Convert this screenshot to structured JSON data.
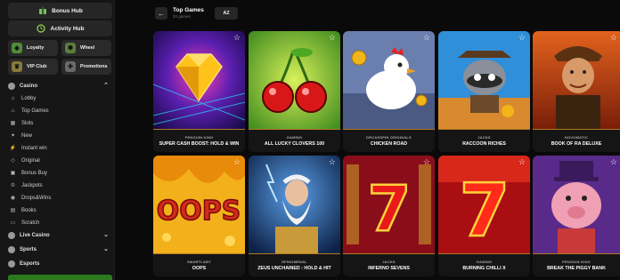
{
  "sidebar": {
    "bonus_hub": "Bonus Hub",
    "activity_hub": "Activity Hub",
    "tiles": [
      {
        "label": "Loyalty",
        "icon": "shield-icon"
      },
      {
        "label": "Wheel",
        "icon": "wheel-icon"
      },
      {
        "label": "VIP Club",
        "icon": "crown-icon"
      },
      {
        "label": "Promotions",
        "icon": "gift-icon"
      }
    ],
    "casino_label": "Casino",
    "items": [
      {
        "label": "Lobby",
        "icon": "home-icon"
      },
      {
        "label": "Top Games",
        "icon": "flame-icon"
      },
      {
        "label": "Slots",
        "icon": "slot-icon"
      },
      {
        "label": "New",
        "icon": "new-icon"
      },
      {
        "label": "Instant win",
        "icon": "bolt-icon"
      },
      {
        "label": "Original",
        "icon": "diamond-icon"
      },
      {
        "label": "Bonus Buy",
        "icon": "cart-icon"
      },
      {
        "label": "Jackpots",
        "icon": "trophy-icon"
      },
      {
        "label": "Drops&Wins",
        "icon": "drop-icon"
      },
      {
        "label": "Books",
        "icon": "book-icon"
      },
      {
        "label": "Scratch",
        "icon": "ticket-icon"
      }
    ],
    "live_casino": "Live Casino",
    "sports": "Sports",
    "esports": "Esports"
  },
  "header": {
    "title": "Top Games",
    "subtitle": "20 games",
    "sort_label": "AZ"
  },
  "games": [
    {
      "provider": "PENGUIN KING",
      "name": "SUPER CASH BOOST: HOLD & WIN"
    },
    {
      "provider": "GAMING",
      "name": "ALL LUCKY CLOVERS 100"
    },
    {
      "provider": "DRCASSPIN ORIGINALS",
      "name": "CHICKEN ROAD"
    },
    {
      "provider": "JACKS",
      "name": "RACCOON RICHES"
    },
    {
      "provider": "NOVOMATIC",
      "name": "BOOK OF RA DELUXE"
    },
    {
      "provider": "SMARTLABY",
      "name": "OOPS"
    },
    {
      "provider": "SPINOMENAL",
      "name": "ZEUS UNCHAINED : HOLD & HIT"
    },
    {
      "provider": "JACKS",
      "name": "INFERNO SEVENS"
    },
    {
      "provider": "GAMING",
      "name": "BURNING CHILLI X"
    },
    {
      "provider": "PENGUIN KING",
      "name": "BREAK THE PIGGY BANK"
    }
  ],
  "colors": {
    "accent_gold": "#b07a22",
    "sidebar_bg": "#161616",
    "page_bg": "#0a0a0a"
  }
}
